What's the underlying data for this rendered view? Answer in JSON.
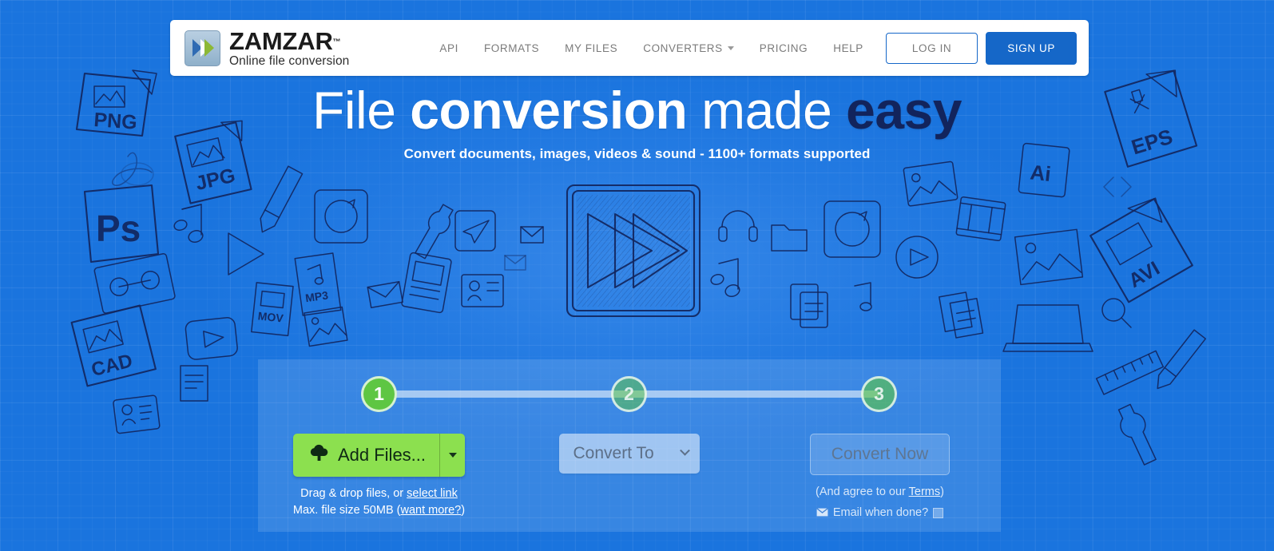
{
  "header": {
    "logo": {
      "word": "ZAMZAR",
      "tm": "™",
      "tagline": "Online file conversion",
      "icon": "double-chevron-logo"
    },
    "nav": [
      {
        "label": "API",
        "name": "nav-api"
      },
      {
        "label": "FORMATS",
        "name": "nav-formats"
      },
      {
        "label": "MY FILES",
        "name": "nav-my-files"
      },
      {
        "label": "CONVERTERS",
        "name": "nav-converters",
        "has_caret": true
      },
      {
        "label": "PRICING",
        "name": "nav-pricing"
      },
      {
        "label": "HELP",
        "name": "nav-help"
      }
    ],
    "login_label": "LOG IN",
    "signup_label": "SIGN UP"
  },
  "hero": {
    "headline_part1": "File ",
    "headline_part2": "conversion",
    "headline_part3": " made ",
    "headline_part4": "easy",
    "subheadline": "Convert documents, images, videos & sound - 1100+ formats supported",
    "center_icon": "fast-forward-sketch-icon"
  },
  "converter": {
    "steps": [
      {
        "number": "1",
        "state": "active"
      },
      {
        "number": "2",
        "state": "inactive"
      },
      {
        "number": "3",
        "state": "inactive"
      }
    ],
    "add_files": {
      "label": "Add Files...",
      "icon": "cloud-upload-icon",
      "dropdown_icon": "caret-down-icon"
    },
    "add_files_hint_line1_text": "Drag & drop files, or ",
    "add_files_hint_line1_link": "select link",
    "add_files_hint_line2_text": "Max. file size 50MB (",
    "add_files_hint_line2_link": "want more?",
    "add_files_hint_line2_tail": ")",
    "convert_to": {
      "value": "Convert To",
      "icon": "chevron-down-icon"
    },
    "convert_now": {
      "label": "Convert Now"
    },
    "terms_prefix": "(And agree to our ",
    "terms_link": "Terms",
    "terms_suffix": ")",
    "email_when_done_label": "Email when done?",
    "email_icon": "envelope-icon"
  },
  "colors": {
    "background_blue": "#1a74de",
    "accent_green": "#5ec643",
    "button_green": "#8ce04f",
    "brand_blue": "#1567c8",
    "headline_navy": "#12245c",
    "sketch_navy": "#12265e"
  },
  "background_sketch_labels": [
    "PNG",
    "JPG",
    "PS",
    "CAD",
    "MOV",
    "MP3",
    "EPS",
    "Ai",
    "AVI"
  ]
}
